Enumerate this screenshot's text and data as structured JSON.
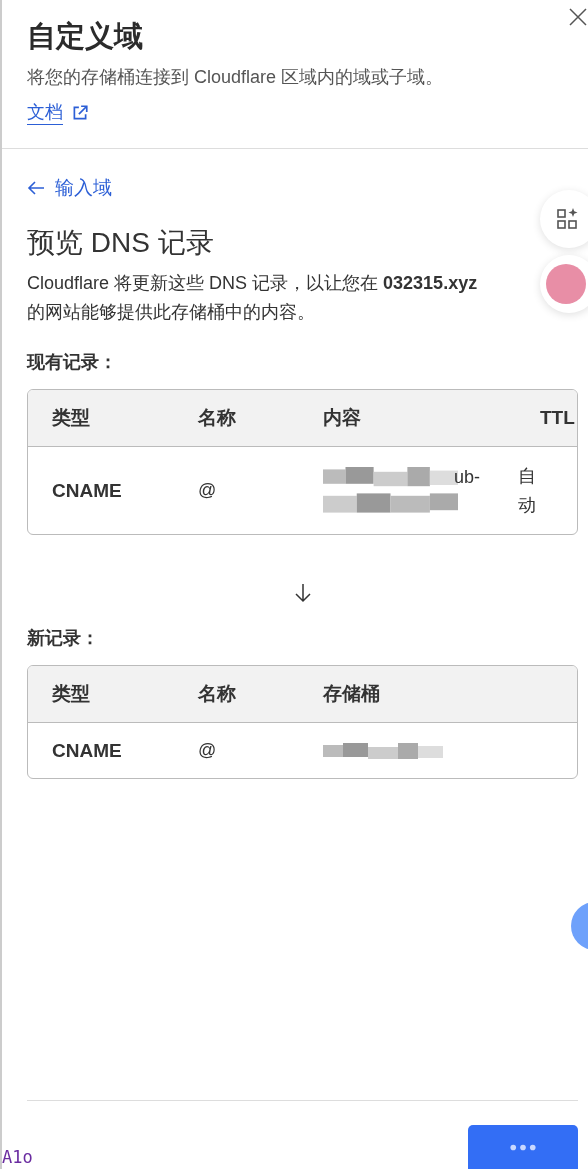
{
  "panel": {
    "title": "自定义域",
    "subtitle": "将您的存储桶连接到 Cloudflare 区域内的域或子域。",
    "docs_link": "文档"
  },
  "back_link": "输入域",
  "heading": "预览 DNS 记录",
  "description": "Cloudflare 将更新这些 DNS 记录，以让您在 **032315.xyz** 的网站能够提供此存储桶中的内容。",
  "existing": {
    "label": "现有记录：",
    "columns": [
      "类型",
      "名称",
      "内容",
      "TTL"
    ],
    "rows": [
      {
        "type": "CNAME",
        "name": "@",
        "content": "ub-",
        "content_redacted": true,
        "ttl": "自动"
      }
    ]
  },
  "new": {
    "label": "新记录：",
    "columns": [
      "类型",
      "名称",
      "存储桶"
    ],
    "rows": [
      {
        "type": "CNAME",
        "name": "@",
        "content": "",
        "content_redacted": true
      }
    ]
  },
  "footer": {
    "button_loading": true
  },
  "corner_text": "A1o"
}
